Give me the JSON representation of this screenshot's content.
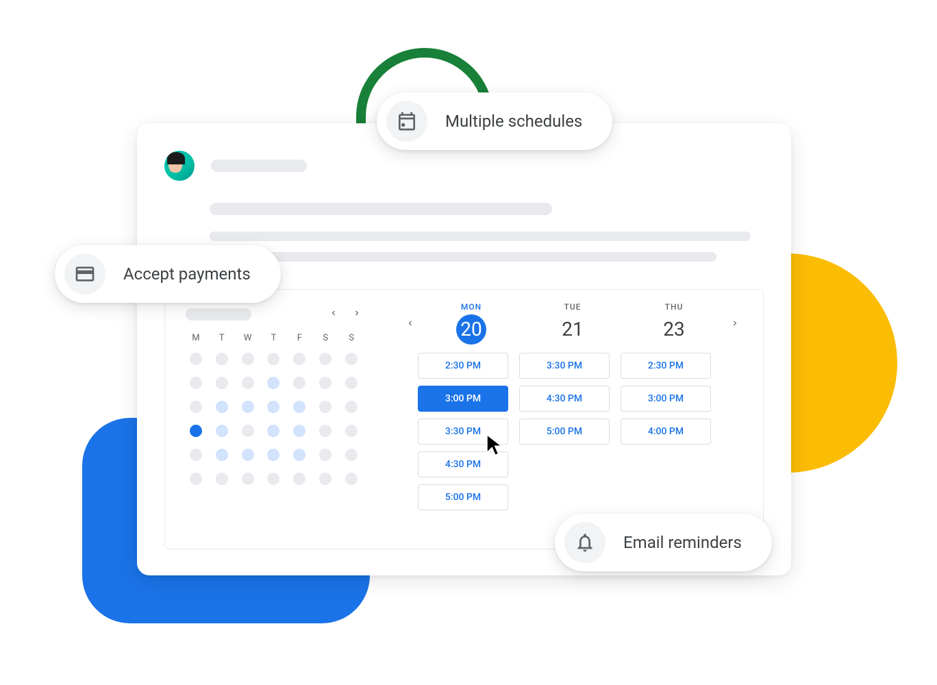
{
  "features": {
    "payments": "Accept payments",
    "schedules": "Multiple schedules",
    "reminders": "Email reminders"
  },
  "miniCalendar": {
    "weekdays": [
      "M",
      "T",
      "W",
      "T",
      "F",
      "S",
      "S"
    ],
    "cells": [
      {
        "type": "grey"
      },
      {
        "type": "grey"
      },
      {
        "type": "grey"
      },
      {
        "type": "grey"
      },
      {
        "type": "grey"
      },
      {
        "type": "grey"
      },
      {
        "type": "grey"
      },
      {
        "type": "grey"
      },
      {
        "type": "grey"
      },
      {
        "type": "grey"
      },
      {
        "type": "avail"
      },
      {
        "type": "grey"
      },
      {
        "type": "grey"
      },
      {
        "type": "grey"
      },
      {
        "type": "grey"
      },
      {
        "type": "avail"
      },
      {
        "type": "avail"
      },
      {
        "type": "avail"
      },
      {
        "type": "avail"
      },
      {
        "type": "grey"
      },
      {
        "type": "grey"
      },
      {
        "type": "selected"
      },
      {
        "type": "avail"
      },
      {
        "type": "grey"
      },
      {
        "type": "avail"
      },
      {
        "type": "avail"
      },
      {
        "type": "grey"
      },
      {
        "type": "grey"
      },
      {
        "type": "grey"
      },
      {
        "type": "avail"
      },
      {
        "type": "avail"
      },
      {
        "type": "avail"
      },
      {
        "type": "avail"
      },
      {
        "type": "grey"
      },
      {
        "type": "grey"
      },
      {
        "type": "grey"
      },
      {
        "type": "grey"
      },
      {
        "type": "grey"
      },
      {
        "type": "grey"
      },
      {
        "type": "grey"
      },
      {
        "type": "grey"
      },
      {
        "type": "grey"
      }
    ]
  },
  "dayColumns": [
    {
      "dow": "MON",
      "day": "20",
      "active": true,
      "slots": [
        {
          "time": "2:30 PM",
          "selected": false
        },
        {
          "time": "3:00 PM",
          "selected": true
        },
        {
          "time": "3:30 PM",
          "selected": false
        },
        {
          "time": "4:30 PM",
          "selected": false
        },
        {
          "time": "5:00 PM",
          "selected": false
        }
      ]
    },
    {
      "dow": "TUE",
      "day": "21",
      "active": false,
      "slots": [
        {
          "time": "3:30 PM",
          "selected": false
        },
        {
          "time": "4:30 PM",
          "selected": false
        },
        {
          "time": "5:00 PM",
          "selected": false
        }
      ]
    },
    {
      "dow": "THU",
      "day": "23",
      "active": false,
      "slots": [
        {
          "time": "2:30 PM",
          "selected": false
        },
        {
          "time": "3:00 PM",
          "selected": false
        },
        {
          "time": "4:00 PM",
          "selected": false
        }
      ]
    }
  ],
  "colors": {
    "primary": "#1a73e8",
    "yellow": "#fbbc04",
    "green": "#188038",
    "grey": "#e8eaed",
    "availBlue": "#d2e3fc"
  }
}
